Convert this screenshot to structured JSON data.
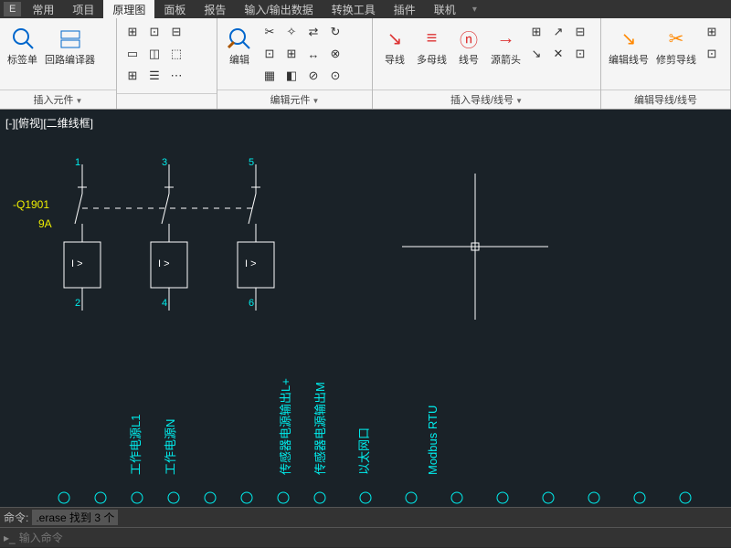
{
  "menubar": {
    "e": "E",
    "tabs": [
      "常用",
      "项目",
      "原理图",
      "面板",
      "报告",
      "输入/输出数据",
      "转换工具",
      "插件",
      "联机"
    ],
    "active_index": 2
  },
  "ribbon": {
    "panels": [
      {
        "label": "插入元件",
        "buttons": [
          "标签单",
          "回路编译器"
        ]
      },
      {
        "label": "编辑元件",
        "buttons": [
          "编辑"
        ]
      },
      {
        "label": "插入导线/线号",
        "buttons": [
          "导线",
          "多母线",
          "线号",
          "源箭头"
        ]
      },
      {
        "label": "编辑导线/线号",
        "buttons": [
          "编辑线号",
          "修剪导线"
        ]
      }
    ]
  },
  "canvas": {
    "title": "[-][俯视][二维线框]",
    "refdes": "-Q1901",
    "rating": "9A",
    "pins": [
      "1",
      "3",
      "5",
      "2",
      "4",
      "6"
    ],
    "annot": "I >",
    "labels": [
      "工作电源L1",
      "工作电源N",
      "传感器电源输出L+",
      "传感器电源输出M",
      "以太网口",
      "Modbus RTU"
    ]
  },
  "cmd": {
    "prompt": "命令:",
    "text": ".erase 找到 3 个",
    "hint": "输入命令"
  }
}
